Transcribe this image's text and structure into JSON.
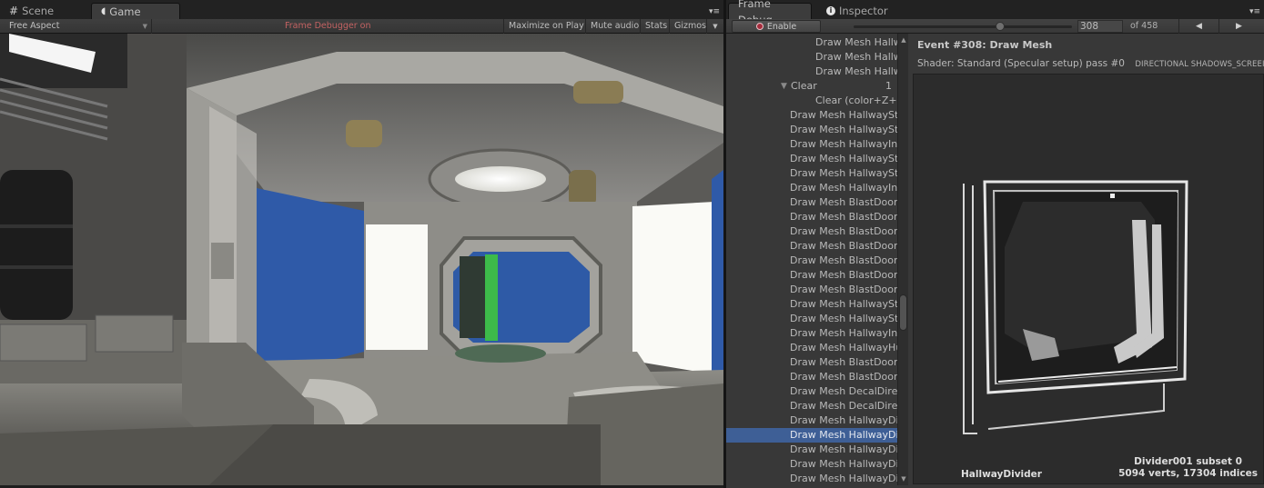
{
  "left_panel": {
    "tabs": [
      {
        "label": "Scene",
        "icon": "grid-icon",
        "active": false
      },
      {
        "label": "Game",
        "icon": "pacman-icon",
        "active": true
      }
    ],
    "toolbar": {
      "aspect": "Free Aspect",
      "status": "Frame Debugger on",
      "buttons": [
        "Maximize on Play",
        "Mute audio",
        "Stats",
        "Gizmos"
      ]
    }
  },
  "right_panel": {
    "tabs": [
      {
        "label": "Frame Debug",
        "icon": "",
        "active": true
      },
      {
        "label": "Inspector",
        "icon": "info-icon",
        "active": false
      }
    ],
    "toolbar": {
      "enable_label": "Enable",
      "current_event": "308",
      "total_label": "of 458",
      "slider_fraction": 0.672
    },
    "events": [
      {
        "label": "Draw Mesh Hallw",
        "indent": 3
      },
      {
        "label": "Draw Mesh Hallw",
        "indent": 3
      },
      {
        "label": "Draw Mesh Hallw",
        "indent": 3
      },
      {
        "label": "Clear",
        "indent": 2,
        "group": true,
        "count": "1"
      },
      {
        "label": "Clear (color+Z+ste",
        "indent": 3
      },
      {
        "label": "Draw Mesh HallwayStr",
        "indent": 2
      },
      {
        "label": "Draw Mesh HallwayStr",
        "indent": 2
      },
      {
        "label": "Draw Mesh HallwayInt",
        "indent": 2
      },
      {
        "label": "Draw Mesh HallwayStr",
        "indent": 2
      },
      {
        "label": "Draw Mesh HallwayStr",
        "indent": 2
      },
      {
        "label": "Draw Mesh HallwayInt",
        "indent": 2
      },
      {
        "label": "Draw Mesh BlastDoorl",
        "indent": 2
      },
      {
        "label": "Draw Mesh BlastDoorl",
        "indent": 2
      },
      {
        "label": "Draw Mesh BlastDoorl",
        "indent": 2
      },
      {
        "label": "Draw Mesh BlastDoorl",
        "indent": 2
      },
      {
        "label": "Draw Mesh BlastDoorl",
        "indent": 2
      },
      {
        "label": "Draw Mesh BlastDoorl",
        "indent": 2
      },
      {
        "label": "Draw Mesh BlastDoorl",
        "indent": 2
      },
      {
        "label": "Draw Mesh HallwayStr",
        "indent": 2
      },
      {
        "label": "Draw Mesh HallwayStr",
        "indent": 2
      },
      {
        "label": "Draw Mesh HallwayInt",
        "indent": 2
      },
      {
        "label": "Draw Mesh HallwayHu",
        "indent": 2
      },
      {
        "label": "Draw Mesh BlastDoorl",
        "indent": 2
      },
      {
        "label": "Draw Mesh BlastDoorl",
        "indent": 2
      },
      {
        "label": "Draw Mesh DecalDirec",
        "indent": 2
      },
      {
        "label": "Draw Mesh DecalDirec",
        "indent": 2
      },
      {
        "label": "Draw Mesh HallwayDiv",
        "indent": 2
      },
      {
        "label": "Draw Mesh HallwayDiv",
        "indent": 2,
        "selected": true
      },
      {
        "label": "Draw Mesh HallwayDiv",
        "indent": 2
      },
      {
        "label": "Draw Mesh HallwayDiv",
        "indent": 2
      },
      {
        "label": "Draw Mesh HallwayDiv",
        "indent": 2
      }
    ],
    "detail": {
      "title": "Event #308: Draw Mesh",
      "shader": "Shader: Standard (Specular setup) pass #0",
      "keywords": "DIRECTIONAL SHADOWS_SCREEI",
      "mesh_name": "HallwayDivider",
      "mesh_subset": "Divider001 subset 0",
      "mesh_stats": "5094 verts, 17304 indices"
    }
  },
  "colors": {
    "selection": "#3e5f96",
    "status_red": "#c26262",
    "panel_bg": "#383838",
    "scene_blue": "#2f5aa8",
    "scene_green": "#39c43a"
  }
}
